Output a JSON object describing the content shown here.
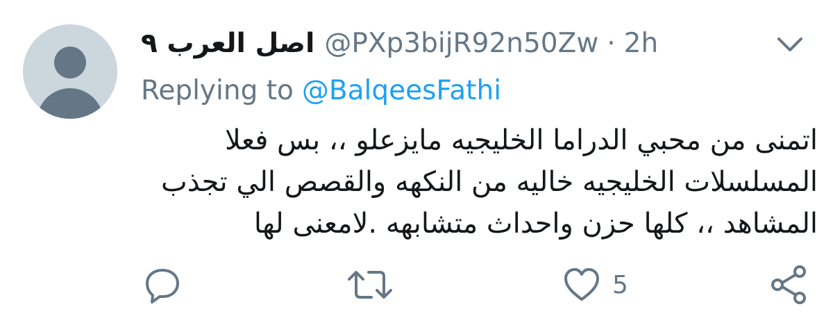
{
  "tweet": {
    "display_name": "اصل العرب ٩",
    "handle": "@PXp3bijR92n50Zw",
    "separator": "·",
    "time": "2h",
    "replying_label": "Replying to",
    "replying_to": "@BalqeesFathi",
    "text": "اتمنى من محبي الدراما الخليجيه مايزعلو ،، بس فعلا\nالمسلسلات الخليجيه خاليه من النكهه والقصص الي تجذب\nالمشاهد ،، كلها حزن واحداث متشابهه .لامعنى لها"
  },
  "actions": {
    "reply_icon": "reply-icon",
    "retweet_icon": "retweet-icon",
    "like_icon": "like-icon",
    "like_count": "5",
    "share_icon": "share-icon"
  },
  "colors": {
    "text": "#14171a",
    "secondary": "#657786",
    "link": "#1da1f2",
    "avatar_bg": "#ccd6dd"
  }
}
